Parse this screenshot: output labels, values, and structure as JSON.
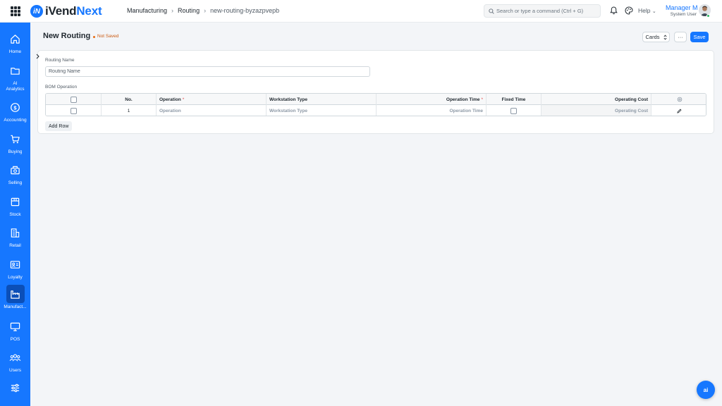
{
  "brand": {
    "logo_mark": "iN",
    "name_part1": "iVend",
    "name_part2": "Next",
    "accent_color": "#1677ff"
  },
  "breadcrumb": {
    "items": [
      "Manufacturing",
      "Routing"
    ],
    "current": "new-routing-byzazpvepb"
  },
  "search": {
    "placeholder": "Search or type a command (Ctrl + G)"
  },
  "navbar": {
    "help_label": "Help",
    "user_name": "Manager M",
    "user_role": "System User"
  },
  "sidebar": {
    "items": [
      {
        "label": "Home",
        "icon": "home-icon"
      },
      {
        "label": "AI\nAnalytics",
        "icon": "folder-icon"
      },
      {
        "label": "Accounting",
        "icon": "dollar-icon"
      },
      {
        "label": "Buying",
        "icon": "cart-icon"
      },
      {
        "label": "Selling",
        "icon": "register-icon"
      },
      {
        "label": "Stock",
        "icon": "box-icon"
      },
      {
        "label": "Retail",
        "icon": "store-icon"
      },
      {
        "label": "Loyalty",
        "icon": "id-card-icon"
      },
      {
        "label": "Manufact...",
        "icon": "factory-icon"
      },
      {
        "label": "POS",
        "icon": "monitor-icon"
      },
      {
        "label": "Users",
        "icon": "users-icon"
      },
      {
        "label": "",
        "icon": "sliders-icon"
      }
    ],
    "active_index": 8
  },
  "page": {
    "title": "New Routing",
    "status": "Not Saved",
    "view_select": "Cards",
    "more_label": "···",
    "save_label": "Save"
  },
  "form": {
    "routing_name_label": "Routing Name",
    "routing_name_placeholder": "Routing Name",
    "routing_name_value": "",
    "bom_operation_label": "BOM Operation",
    "table": {
      "headers": {
        "no": "No.",
        "operation": "Operation",
        "workstation_type": "Workstation Type",
        "operation_time": "Operation Time",
        "fixed_time": "Fixed Time",
        "operating_cost": "Operating Cost"
      },
      "required_marker": "*",
      "rows": [
        {
          "no": "1",
          "operation": "Operation",
          "workstation_type": "Workstation Type",
          "operation_time": "Operation Time",
          "fixed_time": false,
          "operating_cost": "Operating Cost"
        }
      ]
    },
    "add_row_label": "Add Row"
  },
  "assistant": {
    "label": "ai"
  }
}
